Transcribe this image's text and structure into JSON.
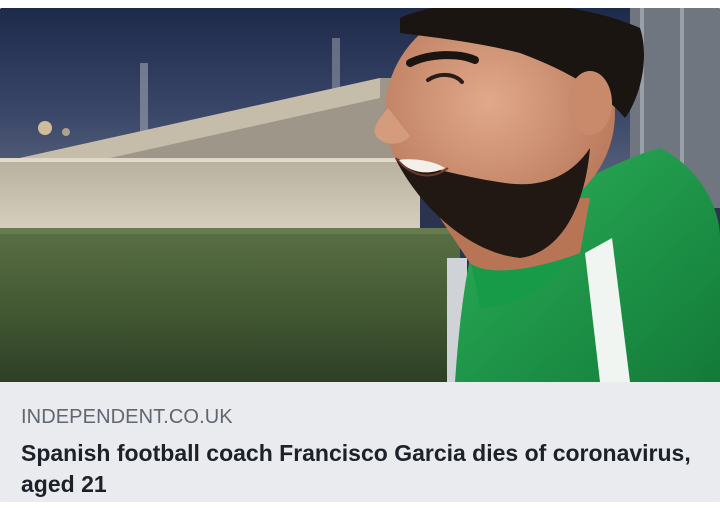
{
  "link_preview": {
    "image": {
      "subject": "photo-of-smiling-man-in-green-jacket-at-football-pitch"
    },
    "source": "INDEPENDENT.CO.UK",
    "headline": "Spanish football coach Francisco Garcia dies of coronavirus, aged 21"
  },
  "colors": {
    "caption_background": "#e9ebee",
    "source_text": "#606770",
    "headline_text": "#1d2129",
    "jacket_green": "#1f9a4a"
  }
}
